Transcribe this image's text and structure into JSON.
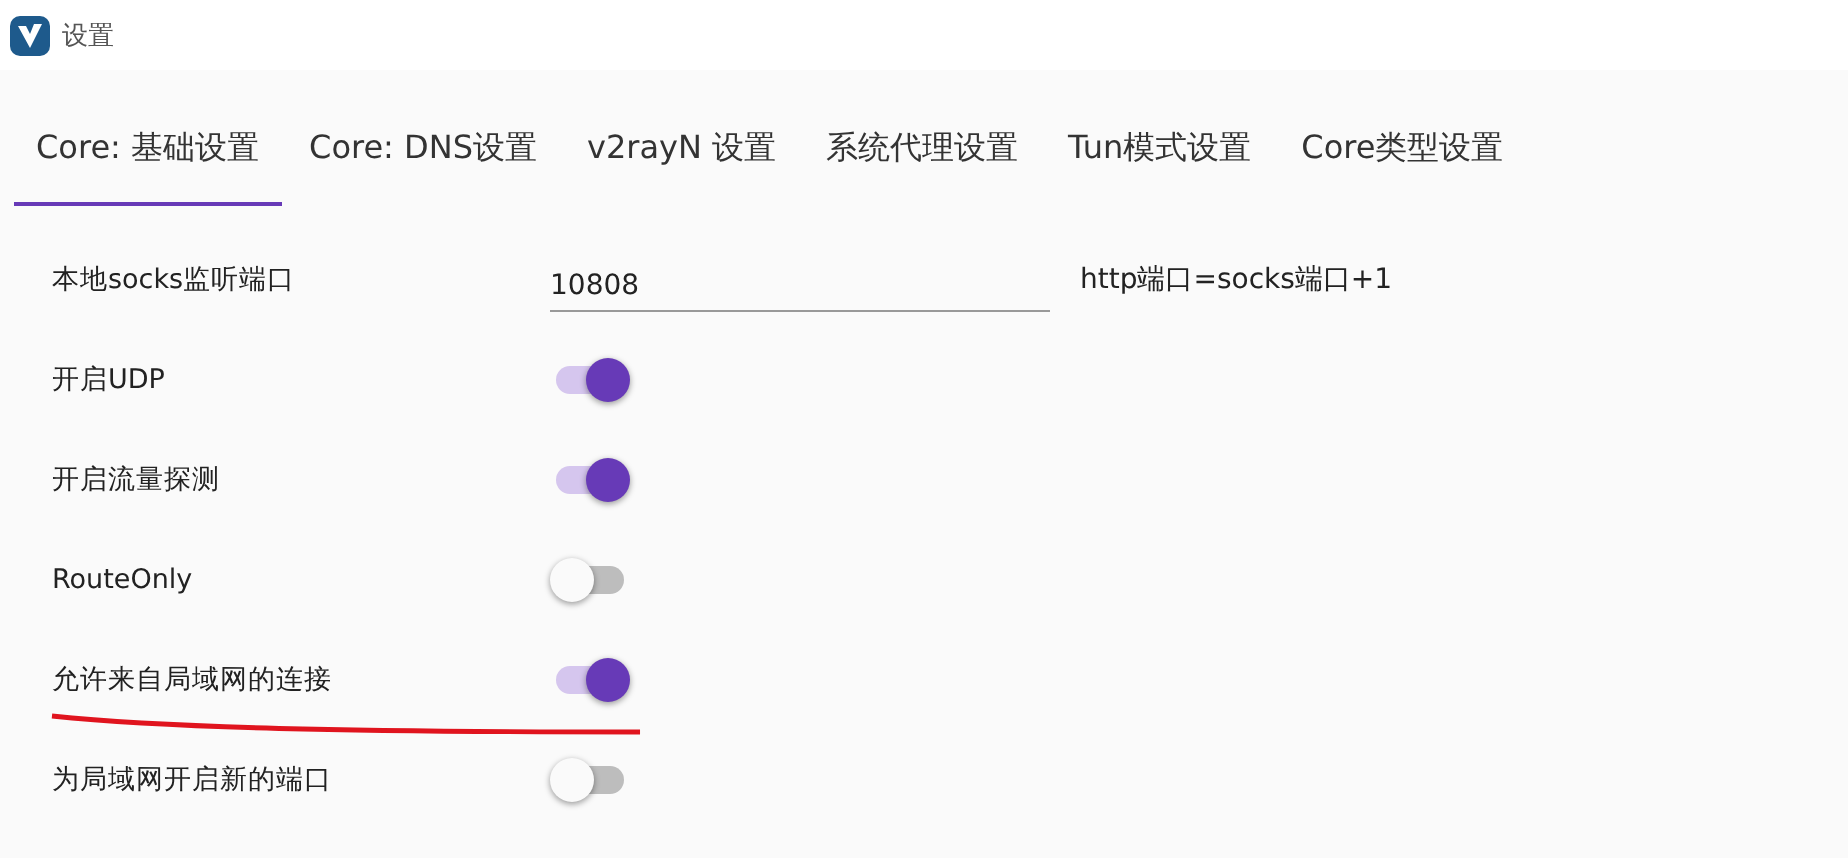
{
  "window": {
    "title": "设置"
  },
  "tabs": [
    {
      "label": "Core: 基础设置",
      "selected": true
    },
    {
      "label": "Core: DNS设置",
      "selected": false
    },
    {
      "label": "v2rayN 设置",
      "selected": false
    },
    {
      "label": "系统代理设置",
      "selected": false
    },
    {
      "label": "Tun模式设置",
      "selected": false
    },
    {
      "label": "Core类型设置",
      "selected": false
    }
  ],
  "settings": [
    {
      "kind": "field",
      "label": "本地socks监听端口",
      "value": "10808",
      "hint": "http端口=socks端口+1"
    },
    {
      "kind": "toggle",
      "label": "开启UDP",
      "on": true
    },
    {
      "kind": "toggle",
      "label": "开启流量探测",
      "on": true
    },
    {
      "kind": "toggle",
      "label": "RouteOnly",
      "on": false
    },
    {
      "kind": "toggle",
      "label": "允许来自局域网的连接",
      "on": true
    },
    {
      "kind": "toggle",
      "label": "为局域网开启新的端口",
      "on": false
    }
  ]
}
